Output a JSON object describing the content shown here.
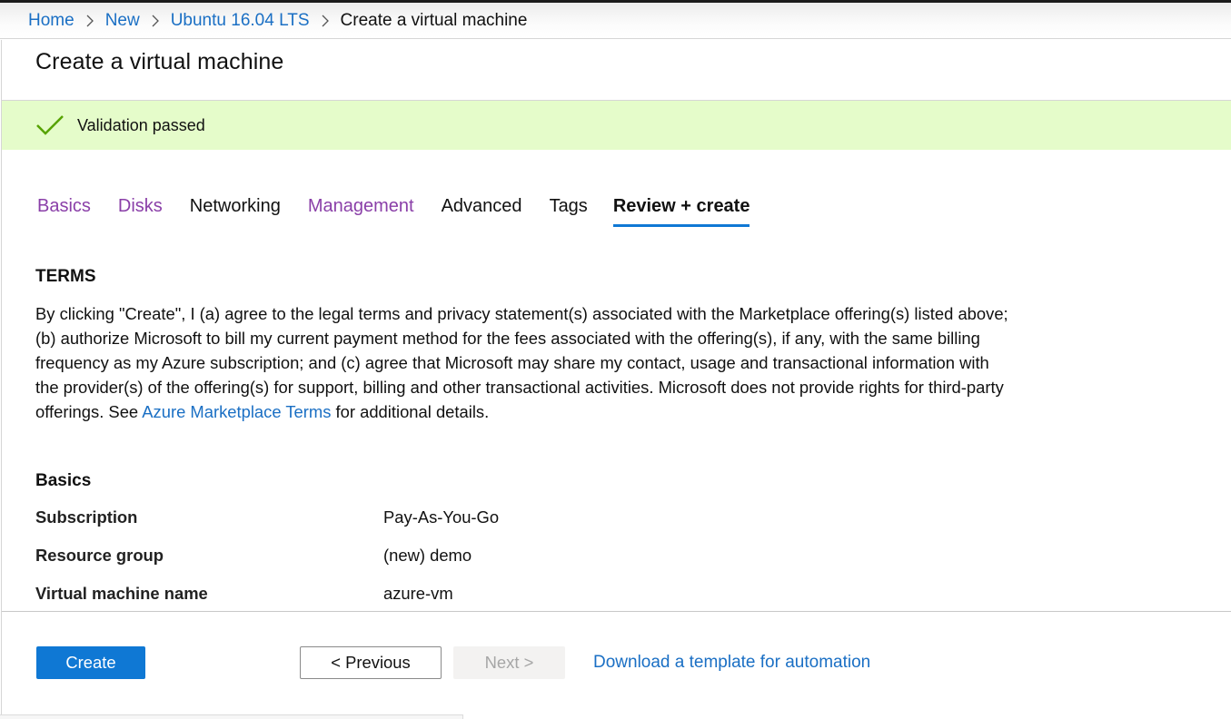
{
  "breadcrumb": {
    "items": [
      {
        "label": "Home",
        "link": true
      },
      {
        "label": "New",
        "link": true
      },
      {
        "label": "Ubuntu 16.04 LTS",
        "link": true
      },
      {
        "label": "Create a virtual machine",
        "link": false
      }
    ],
    "separator_icon": "chevron-right-icon"
  },
  "page": {
    "title": "Create a virtual machine"
  },
  "validation": {
    "icon": "checkmark-icon",
    "text": "Validation passed",
    "background": "#e5fcca",
    "icon_color": "#57a300"
  },
  "tabs": [
    {
      "label": "Basics",
      "state": "visited"
    },
    {
      "label": "Disks",
      "state": "visited"
    },
    {
      "label": "Networking",
      "state": "normal"
    },
    {
      "label": "Management",
      "state": "visited"
    },
    {
      "label": "Advanced",
      "state": "normal"
    },
    {
      "label": "Tags",
      "state": "normal"
    },
    {
      "label": "Review + create",
      "state": "active"
    }
  ],
  "terms": {
    "heading": "TERMS",
    "text_before_link": "By clicking \"Create\", I (a) agree to the legal terms and privacy statement(s) associated with the Marketplace offering(s) listed above; (b) authorize Microsoft to bill my current payment method for the fees associated with the offering(s), if any, with the same billing frequency as my Azure subscription; and (c) agree that Microsoft may share my contact, usage and transactional information with the provider(s) of the offering(s) for support, billing and other transactional activities. Microsoft does not provide rights for third-party offerings. See ",
    "link_text": "Azure Marketplace Terms",
    "text_after_link": " for additional details."
  },
  "basics": {
    "heading": "Basics",
    "rows": [
      {
        "label": "Subscription",
        "value": "Pay-As-You-Go"
      },
      {
        "label": "Resource group",
        "value": "(new) demo"
      },
      {
        "label": "Virtual machine name",
        "value": "azure-vm"
      }
    ]
  },
  "footer": {
    "create_label": "Create",
    "previous_label": "< Previous",
    "next_label": "Next >",
    "next_disabled": true,
    "download_label": "Download a template for automation"
  },
  "colors": {
    "accent": "#0f78d4",
    "link": "#1a6fc4",
    "visited_tab": "#8a3fa8"
  }
}
